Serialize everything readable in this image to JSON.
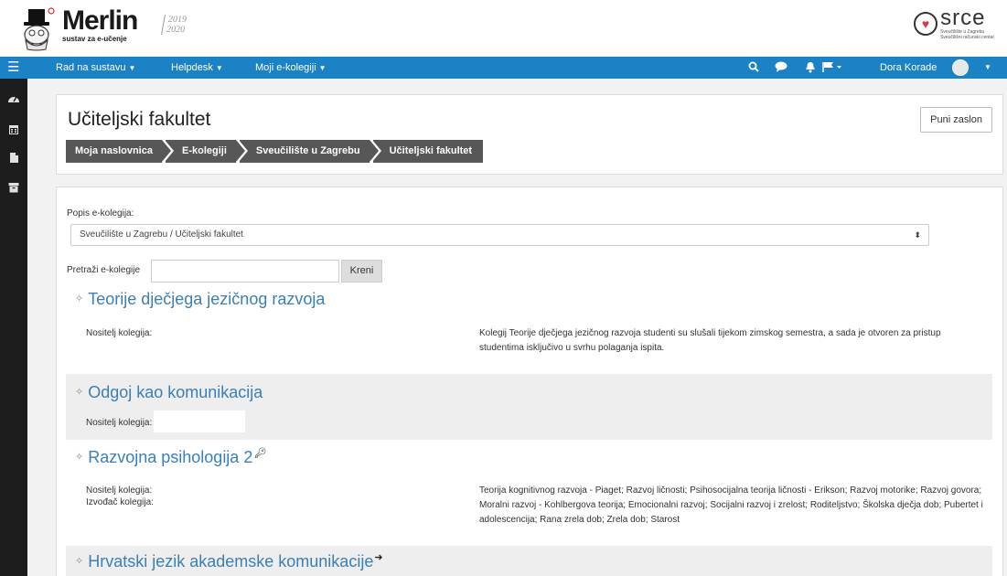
{
  "brand": {
    "name": "Merlin",
    "subtitle": "sustav za e-učenje",
    "years_top": "2019",
    "years_bottom": "2020",
    "partner_name": "srce",
    "partner_line1": "Sveučilište u Zagrebu",
    "partner_line2": "Sveučilišni računski centar"
  },
  "navbar": {
    "menu_icon": "hamburger-icon",
    "items": [
      {
        "label": "Rad na sustavu"
      },
      {
        "label": "Helpdesk"
      },
      {
        "label": "Moji e-kolegiji"
      }
    ],
    "icons": [
      "search-icon",
      "chat-icon",
      "bell-icon",
      "flag-icon"
    ],
    "user_name": "Dora Korade",
    "bg_color": "#1b82c6"
  },
  "sidebar": {
    "icons": [
      "dashboard-icon",
      "calendar-icon",
      "file-icon",
      "archive-icon"
    ]
  },
  "header": {
    "title": "Učiteljski fakultet",
    "fullscreen_label": "Puni zaslon",
    "breadcrumb": [
      "Moja naslovnica",
      "E-kolegiji",
      "Sveučilište u Zagrebu",
      "Učiteljski fakultet"
    ]
  },
  "filters": {
    "list_label": "Popis e-kolegija:",
    "selected_category": "Sveučilište u Zagrebu / Učiteljski fakultet",
    "search_label": "Pretraži e-kolegije",
    "search_value": "",
    "search_button": "Kreni"
  },
  "courses": [
    {
      "title": "Teorije dječjega jezičnog razvoja",
      "teacher_label": "Nositelj kolegija:",
      "description": "Kolegij Teorije dječjega jezičnog razvoja studenti su slušali tijekom zimskog semestra, a sada je otvoren za pristup studentima isključivo u svrhu polaganja ispita."
    },
    {
      "title": "Odgoj kao komunikacija",
      "teacher_label": "Nositelj kolegija:"
    },
    {
      "title": "Razvojna psihologija 2",
      "suffix_icon": "key-icon",
      "teacher_label": "Nositelj kolegija:",
      "performer_label": "Izvođač kolegija:",
      "description": "Teorija kognitivnog razvoja - Piaget; Razvoj ličnosti; Psihosocijalna teorija ličnosti - Erikson; Razvoj motorike; Razvoj govora; Moralni razvoj - Kohlbergova teorija; Emocionalni razvoj; Socijalni razvoj i zrelost; Roditeljstvo; Školska dječja dob; Pubertet i adolescencija; Rana zrela dob; Zrela dob; Starost"
    },
    {
      "title": "Hrvatski jezik akademske komunikacije",
      "suffix_icon": "login-icon"
    }
  ]
}
